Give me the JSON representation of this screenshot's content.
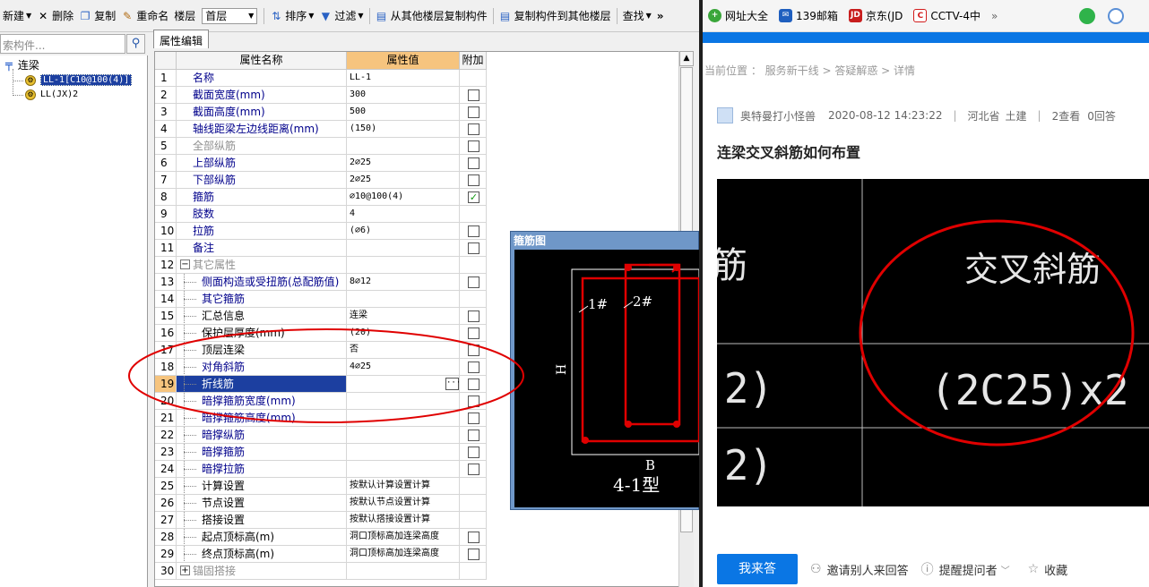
{
  "toolbar": {
    "new": "新建",
    "delete": "删除",
    "copy": "复制",
    "rename": "重命名",
    "floor_label": "楼层",
    "floor_value": "首层",
    "sort": "排序",
    "filter": "过滤",
    "copy_from": "从其他楼层复制构件",
    "copy_to": "复制构件到其他楼层",
    "find": "查找",
    "more": "»"
  },
  "search": {
    "placeholder": "索构件..."
  },
  "tree": {
    "root": "连梁",
    "children": [
      "LL-1[C10@100(4)]",
      "LL(JX)2"
    ]
  },
  "tab": "属性编辑",
  "grid": {
    "headers": [
      "属性名称",
      "属性值",
      "附加"
    ],
    "rows": [
      {
        "n": "1",
        "name": "名称",
        "value": "LL-1",
        "check": ""
      },
      {
        "n": "2",
        "name": "截面宽度(mm)",
        "value": "300",
        "check": "unchecked"
      },
      {
        "n": "3",
        "name": "截面高度(mm)",
        "value": "500",
        "check": "unchecked"
      },
      {
        "n": "4",
        "name": "轴线距梁左边线距离(mm)",
        "value": "(150)",
        "check": "unchecked"
      },
      {
        "n": "5",
        "name": "全部纵筋",
        "value": "",
        "check": "unchecked"
      },
      {
        "n": "6",
        "name": "上部纵筋",
        "value": "2⌀25",
        "check": "unchecked"
      },
      {
        "n": "7",
        "name": "下部纵筋",
        "value": "2⌀25",
        "check": "unchecked"
      },
      {
        "n": "8",
        "name": "箍筋",
        "value": "⌀10@100(4)",
        "check": "checked"
      },
      {
        "n": "9",
        "name": "肢数",
        "value": "4",
        "check": ""
      },
      {
        "n": "10",
        "name": "拉筋",
        "value": "(⌀6)",
        "check": "unchecked"
      },
      {
        "n": "11",
        "name": "备注",
        "value": "",
        "check": "unchecked"
      },
      {
        "n": "12",
        "name": "其它属性",
        "value": "",
        "check": ""
      },
      {
        "n": "13",
        "name": "侧面构造或受扭筋(总配筋值)",
        "value": "8⌀12",
        "check": "unchecked"
      },
      {
        "n": "14",
        "name": "其它箍筋",
        "value": "",
        "check": ""
      },
      {
        "n": "15",
        "name": "汇总信息",
        "value": "连梁",
        "check": "unchecked"
      },
      {
        "n": "16",
        "name": "保护层厚度(mm)",
        "value": "(20)",
        "check": "unchecked"
      },
      {
        "n": "17",
        "name": "顶层连梁",
        "value": "否",
        "check": "unchecked"
      },
      {
        "n": "18",
        "name": "对角斜筋",
        "value": "4⌀25",
        "check": "unchecked"
      },
      {
        "n": "19",
        "name": "折线筋",
        "value": "",
        "check": "unchecked"
      },
      {
        "n": "20",
        "name": "暗撑箍筋宽度(mm)",
        "value": "",
        "check": "unchecked"
      },
      {
        "n": "21",
        "name": "暗撑箍筋高度(mm)",
        "value": "",
        "check": "unchecked"
      },
      {
        "n": "22",
        "name": "暗撑纵筋",
        "value": "",
        "check": "unchecked"
      },
      {
        "n": "23",
        "name": "暗撑箍筋",
        "value": "",
        "check": "unchecked"
      },
      {
        "n": "24",
        "name": "暗撑拉筋",
        "value": "",
        "check": "unchecked"
      },
      {
        "n": "25",
        "name": "计算设置",
        "value": "按默认计算设置计算",
        "check": ""
      },
      {
        "n": "26",
        "name": "节点设置",
        "value": "按默认节点设置计算",
        "check": ""
      },
      {
        "n": "27",
        "name": "搭接设置",
        "value": "按默认搭接设置计算",
        "check": ""
      },
      {
        "n": "28",
        "name": "起点顶标高(m)",
        "value": "洞口顶标高加连梁高度",
        "check": "unchecked"
      },
      {
        "n": "29",
        "name": "终点顶标高(m)",
        "value": "洞口顶标高加连梁高度",
        "check": "unchecked"
      },
      {
        "n": "30",
        "name": "锚固搭接",
        "value": "",
        "check": ""
      }
    ]
  },
  "stirrup": {
    "title": "箍筋图",
    "label1": "1#",
    "label2": "2#",
    "h": "H",
    "b": "B",
    "type": "4-1型"
  },
  "browser": {
    "bookmarks": [
      "网址大全",
      "139邮箱",
      "京东(JD",
      "CCTV-4中",
      "»"
    ],
    "breadcrumb": "当前位置 ： 服务新干线 > 答疑解惑 > 详情",
    "meta": {
      "user": "奥特曼打小怪兽",
      "time": "2020-08-12 14:23:22",
      "location": "河北省",
      "category": "土建",
      "views": "2查看",
      "answers": "0回答"
    },
    "question_title": "连梁交叉斜筋如何布置",
    "cad": {
      "text1": "筋",
      "text2": "交叉斜筋",
      "text3": "(2)",
      "text4": "(2C25)x2",
      "text5": "(2)"
    },
    "actions": {
      "answer": "我来答",
      "invite": "邀请别人来回答",
      "remind": "提醒提问者",
      "collect": "收藏"
    }
  },
  "colors": {
    "accent": "#0a76e4",
    "selection": "#1c3fa0",
    "header_highlight": "#f6c47e",
    "annotation": "#e00000"
  }
}
